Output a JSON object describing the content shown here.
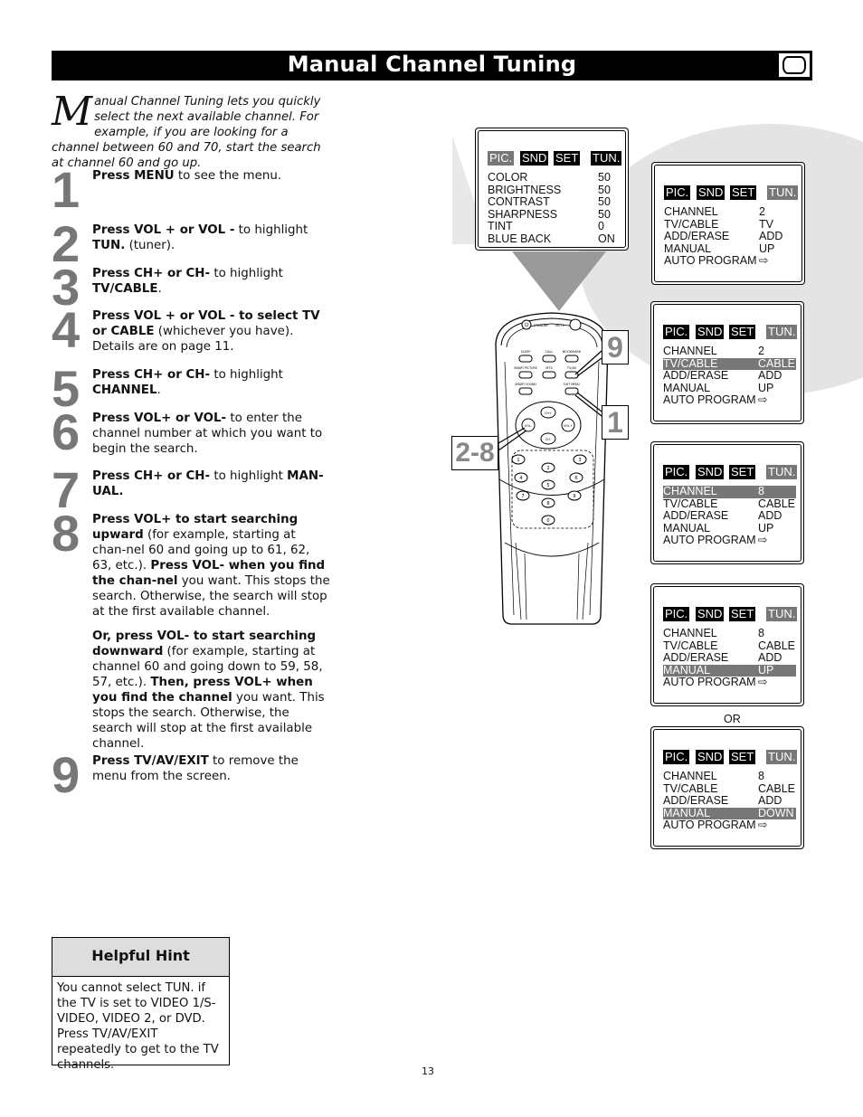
{
  "header": {
    "title": "Manual Channel Tuning",
    "icon": "tv-icon"
  },
  "intro": {
    "dropcap": "M",
    "text": "anual Channel Tuning lets you quickly select the next available channel. For example, if you are looking for a channel between 60 and 70, start the search at channel 60 and go up."
  },
  "steps": [
    {
      "num": "1",
      "bold": "Press MENU",
      "rest": " to see the menu."
    },
    {
      "num": "2",
      "bold": "Press VOL + or VOL -",
      "rest": " to highlight ",
      "bold2": "TUN.",
      "rest2": " (tuner)."
    },
    {
      "num": "3",
      "bold": "Press CH+ or CH-",
      "rest": " to highlight ",
      "bold2": "TV/CABLE",
      "rest2": "."
    },
    {
      "num": "4",
      "bold": "Press VOL + or VOL - to select TV or CABLE",
      "rest": " (whichever you have). Details are on page 11."
    },
    {
      "num": "5",
      "bold": "Press CH+ or CH-",
      "rest": " to highlight ",
      "bold2": "CHANNEL",
      "rest2": "."
    },
    {
      "num": "6",
      "bold": "Press VOL+ or VOL-",
      "rest": " to enter the channel number at which you want to begin the search."
    },
    {
      "num": "7",
      "bold": "Press CH+ or CH-",
      "rest": " to highlight ",
      "bold2": "MAN-UAL.",
      "rest2": ""
    },
    {
      "num": "8",
      "bold": "Press VOL+ to start searching upward",
      "rest": " (for example, starting at chan-nel 60 and going up to 61, 62, 63, etc.). ",
      "bold2": "Press VOL- when you find the chan-nel",
      "rest2": " you want. This stops the search. Otherwise, the search will stop at the first available channel.",
      "p2_bold": "Or, press VOL- to start searching downward",
      "p2_rest": " (for example, starting at channel 60 and going down to 59, 58, 57, etc.). ",
      "p2_bold2": "Then, press VOL+ when you find the channel",
      "p2_rest2": " you want. This stops the search. Otherwise, the search will stop at the first available channel."
    },
    {
      "num": "9",
      "bold": "Press TV/AV/EXIT",
      "rest": " to remove the menu from the screen."
    }
  ],
  "hint": {
    "title": "Helpful Hint",
    "text": "You cannot select TUN. if the TV is set to VIDEO 1/S-VIDEO, VIDEO 2, or DVD. Press TV/AV/EXIT repeatedly to get to the TV channels."
  },
  "page_number": "13",
  "osd_tabs": [
    "PIC.",
    "SND",
    "SET",
    "TUN."
  ],
  "screens": [
    {
      "active_tab": 0,
      "rows": [
        {
          "label": "COLOR",
          "value": "50"
        },
        {
          "label": "BRIGHTNESS",
          "value": "50"
        },
        {
          "label": "CONTRAST",
          "value": "50"
        },
        {
          "label": "SHARPNESS",
          "value": "50"
        },
        {
          "label": "TINT",
          "value": "0"
        },
        {
          "label": "BLUE BACK",
          "value": "ON"
        }
      ],
      "highlight": -1
    },
    {
      "active_tab": 3,
      "rows": [
        {
          "label": "CHANNEL",
          "value": "2"
        },
        {
          "label": "TV/CABLE",
          "value": "TV"
        },
        {
          "label": "ADD/ERASE",
          "value": "ADD"
        },
        {
          "label": "MANUAL",
          "value": "UP"
        },
        {
          "label": "AUTO PROGRAM",
          "value": "⇨"
        }
      ],
      "highlight": -1
    },
    {
      "active_tab": 3,
      "rows": [
        {
          "label": "CHANNEL",
          "value": "2"
        },
        {
          "label": "TV/CABLE",
          "value": "CABLE"
        },
        {
          "label": "ADD/ERASE",
          "value": "ADD"
        },
        {
          "label": "MANUAL",
          "value": "UP"
        },
        {
          "label": "AUTO PROGRAM",
          "value": "⇨"
        }
      ],
      "highlight": 1
    },
    {
      "active_tab": 3,
      "rows": [
        {
          "label": "CHANNEL",
          "value": "8"
        },
        {
          "label": "TV/CABLE",
          "value": "CABLE"
        },
        {
          "label": "ADD/ERASE",
          "value": "ADD"
        },
        {
          "label": "MANUAL",
          "value": "UP"
        },
        {
          "label": "AUTO PROGRAM",
          "value": "⇨"
        }
      ],
      "highlight": 0
    },
    {
      "active_tab": 3,
      "rows": [
        {
          "label": "CHANNEL",
          "value": "8"
        },
        {
          "label": "TV/CABLE",
          "value": "CABLE"
        },
        {
          "label": "ADD/ERASE",
          "value": "ADD"
        },
        {
          "label": "MANUAL",
          "value": "UP"
        },
        {
          "label": "AUTO PROGRAM",
          "value": "⇨"
        }
      ],
      "highlight": 3
    },
    {
      "active_tab": 3,
      "rows": [
        {
          "label": "CHANNEL",
          "value": "8"
        },
        {
          "label": "TV/CABLE",
          "value": "CABLE"
        },
        {
          "label": "ADD/ERASE",
          "value": "ADD"
        },
        {
          "label": "MANUAL",
          "value": "DOWN"
        },
        {
          "label": "AUTO PROGRAM",
          "value": "⇨"
        }
      ],
      "highlight": 3
    }
  ],
  "or_label": "OR",
  "remote": {
    "buttons": {
      "standby": "STANDBY",
      "mute": "MUTE",
      "sleep": "SLEEP",
      "call": "CALL",
      "bookmark": "BOOKMARK",
      "smart_picture": "SMART PICTURE",
      "mts": "MTS",
      "tvav": "TV/AV",
      "smart_sound": "SMART SOUND",
      "exit_menu": "EXIT MENU",
      "ch_up": "CH+",
      "ch_down": "CH-",
      "vol_down": "VOL-",
      "vol_up": "VOL+",
      "digits": [
        "1",
        "2",
        "3",
        "4",
        "5",
        "6",
        "7",
        "8",
        "9",
        "0"
      ]
    },
    "callouts": [
      "9",
      "1",
      "2-8"
    ]
  }
}
